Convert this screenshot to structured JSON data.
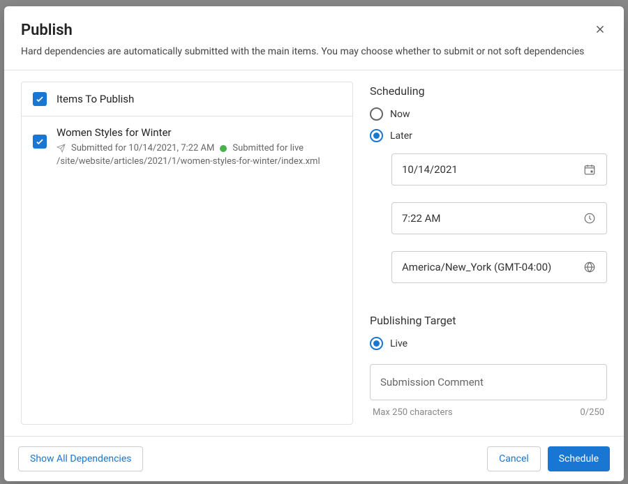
{
  "modal": {
    "title": "Publish",
    "subtitle": "Hard dependencies are automatically submitted with the main items. You may choose whether to submit or not soft dependencies"
  },
  "items": {
    "header_label": "Items To Publish",
    "list": [
      {
        "title": "Women Styles for Winter",
        "submitted_text": "Submitted for 10/14/2021, 7:22 AM",
        "status_text": "Submitted for live",
        "path": "/site/website/articles/2021/1/women-styles-for-winter/index.xml"
      }
    ]
  },
  "scheduling": {
    "title": "Scheduling",
    "now_label": "Now",
    "later_label": "Later",
    "date_value": "10/14/2021",
    "time_value": "7:22 AM",
    "timezone_value": "America/New_York (GMT-04:00)"
  },
  "publishing_target": {
    "title": "Publishing Target",
    "live_label": "Live"
  },
  "comment": {
    "placeholder": "Submission Comment",
    "max_label": "Max 250 characters",
    "counter": "0/250"
  },
  "footer": {
    "show_deps": "Show All Dependencies",
    "cancel": "Cancel",
    "schedule": "Schedule"
  }
}
